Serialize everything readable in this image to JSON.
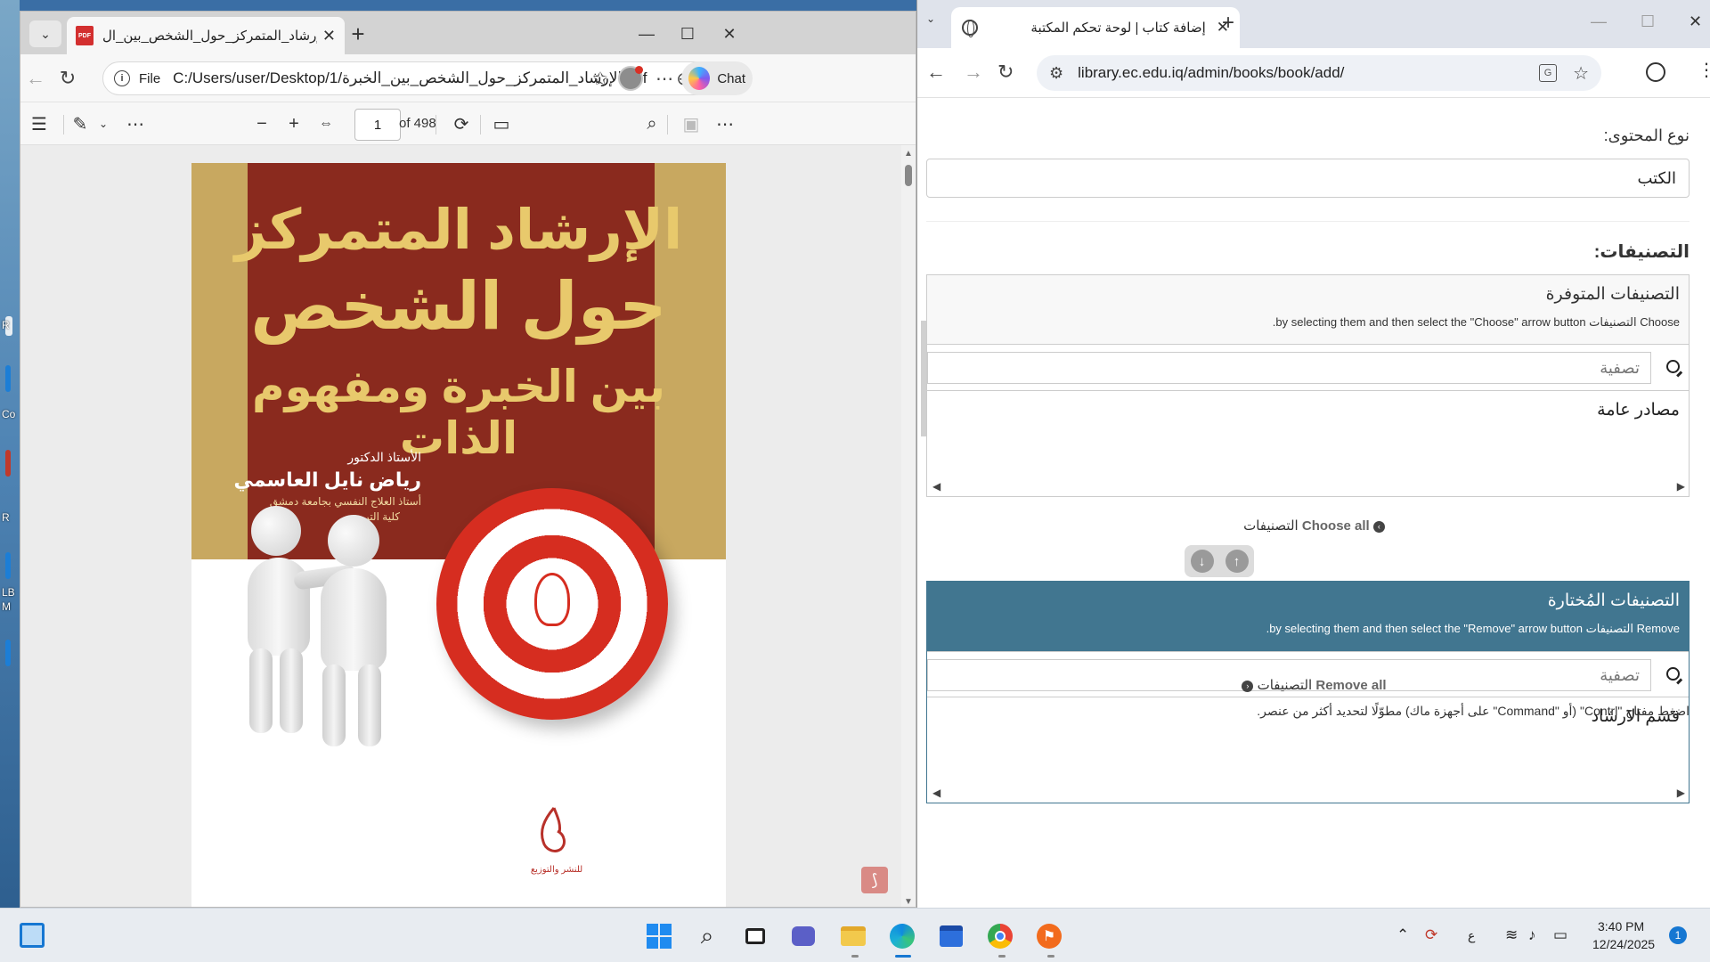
{
  "pdf_window": {
    "tab_title": "الإرشاد_المتمركز_حول_الشخص_بين_ال",
    "file_label": "File",
    "url": "C:/Users/user/Desktop/1/الإرشاد_المتمركز_حول_الشخص_بين_الخبرة.pdf",
    "chat_label": "Chat",
    "page_current": "1",
    "page_total": "of 498",
    "cover": {
      "title_line1": "الإرشاد المتمركز",
      "title_line2": "حول الشخص",
      "title_line3": "بين الخبرة ومفهوم الذات",
      "author_role": "الأستاذ الدكتور",
      "author_name": "رياض نايل العاسمي",
      "author_desc1": "أستاذ العلاج النفسي بجامعة دمشق",
      "author_desc2": "كلية التربية",
      "publisher": "للنشر والتوزيع"
    }
  },
  "admin_window": {
    "tab_title": "إضافة كتاب | لوحة تحكم المكتبة",
    "url": "library.ec.edu.iq/admin/books/book/add/",
    "content_type_label": "نوع المحتوى:",
    "content_type_value": "الكتب",
    "categories_label": "التصنيفات:",
    "available": {
      "title": "التصنيفات المتوفرة",
      "help": "Choose التصنيفات by selecting them and then select the \"Choose\" arrow button.",
      "filter_placeholder": "تصفية",
      "options": [
        "مصادر عامة"
      ],
      "choose_all": "Choose all",
      "choose_all_suffix": "التصنيفات"
    },
    "chosen": {
      "title": "التصنيفات المُختارة",
      "help": "Remove التصنيفات by selecting them and then select the \"Remove\" arrow button.",
      "filter_placeholder": "تصفية",
      "options": [
        "قسم الارشاد"
      ],
      "remove_all": "Remove all",
      "remove_all_suffix": "التصنيفات"
    },
    "multi_select_help": "اضغط مفتاح \"Contrl\" (أو \"Command\" على أجهزة ماك) مطوّلًا لتحديد أكثر من عنصر."
  },
  "taskbar": {
    "lang_indicator": "ع",
    "time": "3:40 PM",
    "date": "12/24/2025",
    "notification_count": "1"
  },
  "desktop_fragments": [
    "R",
    "Co",
    "R",
    "LB",
    "M"
  ]
}
